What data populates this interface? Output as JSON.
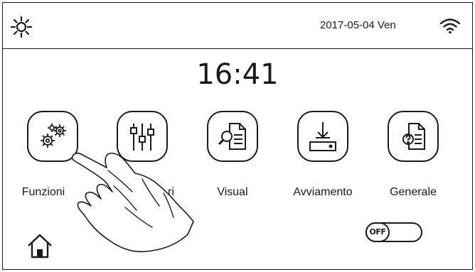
{
  "header": {
    "date_label": "2017-05-04 Ven",
    "brightness_icon": "sun-icon",
    "wifi_icon": "wifi-icon"
  },
  "clock": {
    "time": "16:41"
  },
  "menu": [
    {
      "id": "funzioni",
      "label": "Funzioni",
      "icon": "gears-icon"
    },
    {
      "id": "parametri",
      "label": "ri",
      "icon": "sliders-icon"
    },
    {
      "id": "visual",
      "label": "Visual",
      "icon": "document-search-icon"
    },
    {
      "id": "avviamento",
      "label": "Avviamento",
      "icon": "download-tray-icon"
    },
    {
      "id": "generale",
      "label": "Generale",
      "icon": "document-help-icon"
    }
  ],
  "footer": {
    "home_icon": "home-icon",
    "power_toggle": {
      "state_label": "OFF",
      "on": false
    }
  },
  "overlay": {
    "icon": "pointing-hand-icon"
  }
}
